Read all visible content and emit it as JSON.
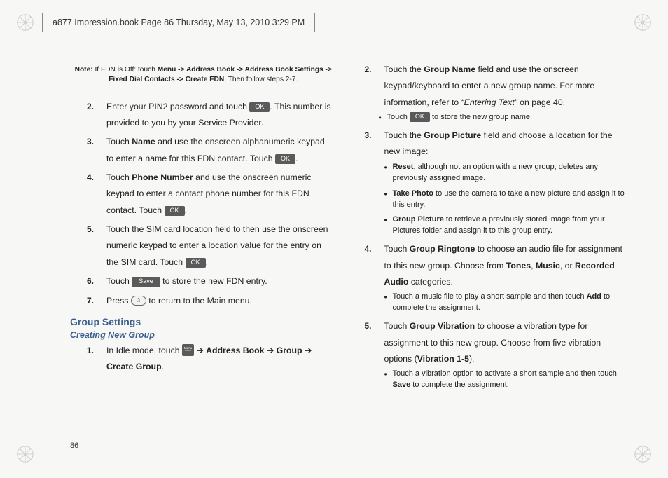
{
  "header": "a877 Impression.book  Page 86  Thursday, May 13, 2010  3:29 PM",
  "note": {
    "label": "Note:",
    "text": " If FDN is Off: touch ",
    "bold1": "Menu -> Address Book -> Address Book Settings -> Fixed Dial Contacts -> Create FDN",
    "text2": ". Then follow steps 2-7."
  },
  "left_steps": [
    {
      "n": "2.",
      "pre": "Enter your PIN2 password and touch ",
      "btn": "OK",
      "post": ". This number is provided to you by your Service Provider."
    },
    {
      "n": "3.",
      "pre": "Touch ",
      "b1": "Name",
      "mid": " and use the onscreen alphanumeric keypad to enter a name for this FDN contact. Touch ",
      "btn": "OK",
      "post": "."
    },
    {
      "n": "4.",
      "pre": "Touch ",
      "b1": "Phone Number",
      "mid": " and use the onscreen numeric keypad to enter a contact phone number for this FDN contact. Touch ",
      "btn": "OK",
      "post": "."
    },
    {
      "n": "5.",
      "plain": "Touch the SIM card location field to then use the onscreen numeric keypad to enter a location value for the entry on the SIM card. Touch ",
      "btn": "OK",
      "post": "."
    },
    {
      "n": "6.",
      "pre": "Touch ",
      "btn": "Save",
      "post": " to store the new FDN entry."
    },
    {
      "n": "7.",
      "pre": "Press ",
      "icon": "home",
      "post": " to return to the Main menu."
    }
  ],
  "sections": {
    "h1": "Group Settings",
    "h2": "Creating New Group"
  },
  "left_steps2": [
    {
      "n": "1.",
      "pre": "In Idle mode, touch ",
      "icon": "menu",
      "arrow": " ➔ ",
      "b1": "Address Book",
      "arrow2": " ➔ ",
      "b2": " Group",
      "arrow3": " ➔ ",
      "b3": "Create Group",
      "post": "."
    }
  ],
  "right": {
    "s2": {
      "n": "2.",
      "pre": "Touch the ",
      "b1": "Group Name",
      "mid": " field and use the onscreen keypad/keyboard to enter a new group name. For more information, refer to ",
      "em": "“Entering Text”",
      "post": "  on page 40."
    },
    "s2_bullet": {
      "pre": "Touch ",
      "btn": "OK",
      "post": " to store the new group name."
    },
    "s3": {
      "n": "3.",
      "pre": "Touch the ",
      "b1": "Group Picture",
      "post": " field and choose a location for the new image:"
    },
    "s3_bullets": [
      {
        "b": "Reset",
        "t": ", although not an option with a new group, deletes any previously assigned image."
      },
      {
        "b": "Take Photo",
        "t": " to use the camera to take a new picture and assign it to this entry."
      },
      {
        "b": "Group Picture",
        "t": " to retrieve a previously stored image from your Pictures folder and assign it to this group entry."
      }
    ],
    "s4": {
      "n": "4.",
      "pre": "Touch ",
      "b1": "Group Ringtone",
      "mid": " to choose an audio file for assignment to this new group. Choose from ",
      "b2": "Tones",
      "sep": ", ",
      "b3": "Music",
      "sep2": ", or ",
      "b4": "Recorded Audio",
      "post": " categories."
    },
    "s4_bullet": {
      "t1": "Touch a music file to play a short sample and then touch ",
      "b": "Add",
      "t2": " to complete the assignment."
    },
    "s5": {
      "n": "5.",
      "pre": "Touch ",
      "b1": "Group Vibration",
      "mid": " to choose a vibration type for assignment to this new group. Choose from five vibration options (",
      "b2": "Vibration 1-5",
      "post": ")."
    },
    "s5_bullet": {
      "t1": "Touch a vibration option to activate a short sample and then touch ",
      "b": "Save",
      "t2": " to complete the assignment."
    }
  },
  "page_number": "86",
  "labels": {
    "ok": "OK",
    "save": "Save"
  }
}
